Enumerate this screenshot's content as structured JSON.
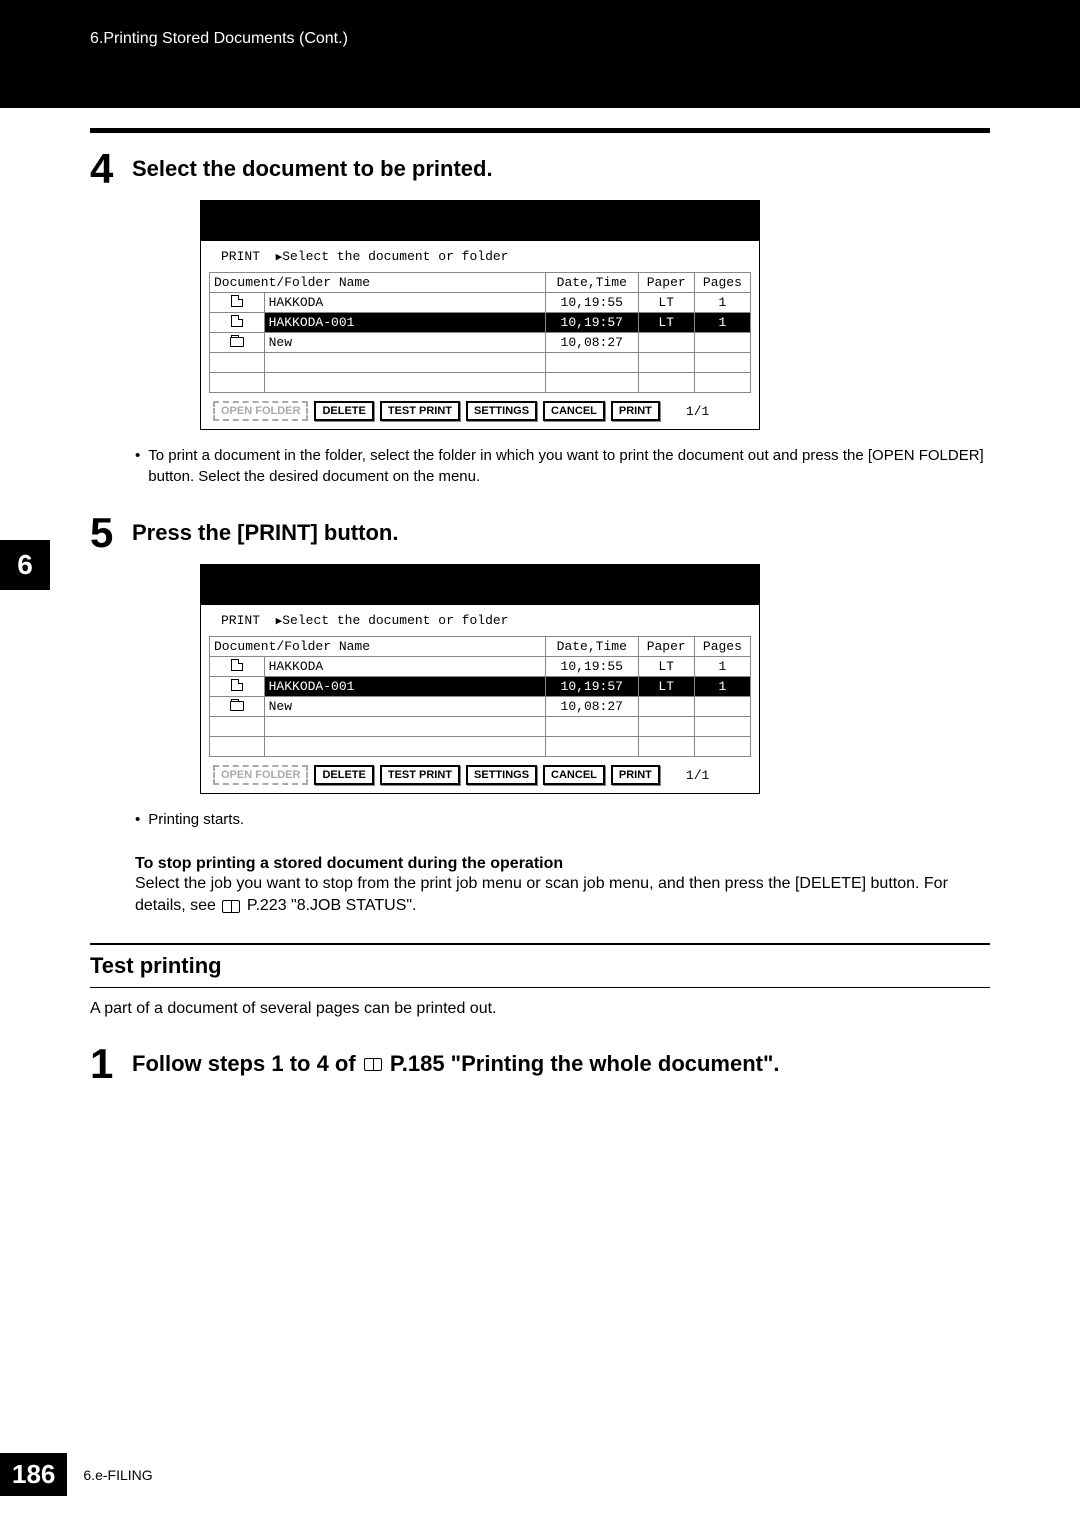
{
  "header": {
    "breadcrumb": "6.Printing Stored Documents (Cont.)"
  },
  "side_tab": "6",
  "step4": {
    "num": "4",
    "title": "Select the document to be printed."
  },
  "step5": {
    "num": "5",
    "title": "Press the [PRINT] button."
  },
  "screenshot": {
    "prompt_label": "PRINT",
    "prompt_text": "Select the document or folder",
    "columns": {
      "name": "Document/Folder Name",
      "date": "Date,Time",
      "paper": "Paper",
      "pages": "Pages"
    },
    "rows": [
      {
        "icon": "doc",
        "name": "HAKKODA",
        "date": "10,19:55",
        "paper": "LT",
        "pages": "1",
        "selected": false
      },
      {
        "icon": "doc",
        "name": "HAKKODA-001",
        "date": "10,19:57",
        "paper": "LT",
        "pages": "1",
        "selected": true
      },
      {
        "icon": "folder",
        "name": "New",
        "date": "10,08:27",
        "paper": "",
        "pages": "",
        "selected": false
      },
      {
        "icon": "",
        "name": "",
        "date": "",
        "paper": "",
        "pages": "",
        "selected": false
      },
      {
        "icon": "",
        "name": "",
        "date": "",
        "paper": "",
        "pages": "",
        "selected": false
      }
    ],
    "buttons": {
      "open_folder": "OPEN FOLDER",
      "delete": "DELETE",
      "test_print": "TEST PRINT",
      "settings": "SETTINGS",
      "cancel": "CANCEL",
      "print": "PRINT"
    },
    "page_counter": "1/1"
  },
  "note4": "To print a document in the folder, select the folder in which you want to print the document out and press the [OPEN FOLDER] button. Select the desired document on the menu.",
  "note5a": "Printing starts.",
  "stop": {
    "heading": "To stop printing a stored document during the operation",
    "text_a": "Select the job you want to stop from the print job menu or scan job menu, and then press the [DELETE] button. For details, see ",
    "text_b": " P.223 \"8.JOB STATUS\"."
  },
  "test_printing": {
    "title": "Test printing",
    "desc": "A part of a document of several pages can be printed out."
  },
  "step1b": {
    "num": "1",
    "title_a": "Follow steps 1 to 4 of ",
    "title_b": " P.185 \"Printing the whole document\"."
  },
  "footer": {
    "page": "186",
    "label": "6.e-FILING"
  }
}
